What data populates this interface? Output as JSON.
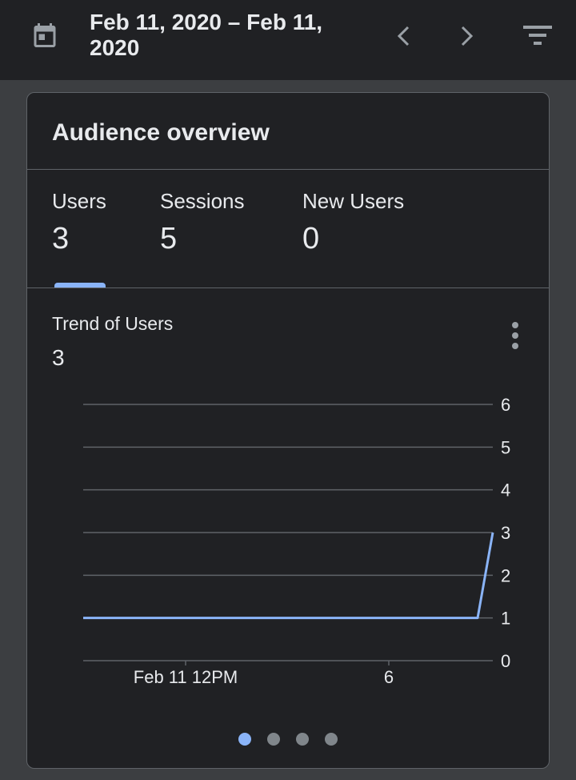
{
  "header": {
    "date_range": "Feb 11, 2020 – Feb 11, 2020",
    "icons": [
      "calendar-icon",
      "chevron-left-icon",
      "chevron-right-icon",
      "filter-icon"
    ]
  },
  "card": {
    "title": "Audience overview",
    "metrics": [
      {
        "label": "Users",
        "value": "3"
      },
      {
        "label": "Sessions",
        "value": "5"
      },
      {
        "label": "New Users",
        "value": "0"
      }
    ],
    "active_metric": "Users",
    "trend_label": "Trend of Users",
    "trend_value": "3",
    "pagination": {
      "pages": 4,
      "active": 1
    }
  },
  "colors": {
    "background": "#202124",
    "accent": "#8ab4f8",
    "text": "#e8eaed",
    "grid": "#5f6368"
  },
  "chart_data": {
    "type": "line",
    "x_tick_labels": [
      "Feb 11 12PM",
      "6"
    ],
    "y_ticks": [
      "0",
      "1",
      "2",
      "3",
      "4",
      "5",
      "6"
    ],
    "ylim": [
      0,
      6
    ],
    "y_axis_position": "right",
    "grid": true,
    "series": [
      {
        "values": [
          1,
          1,
          1,
          1,
          1,
          1,
          1,
          1,
          1,
          1,
          1,
          1,
          1,
          1,
          1,
          1,
          1,
          1,
          1,
          1,
          1,
          1,
          1,
          1,
          1,
          1,
          1,
          3
        ],
        "x_span": "hourly"
      }
    ]
  }
}
